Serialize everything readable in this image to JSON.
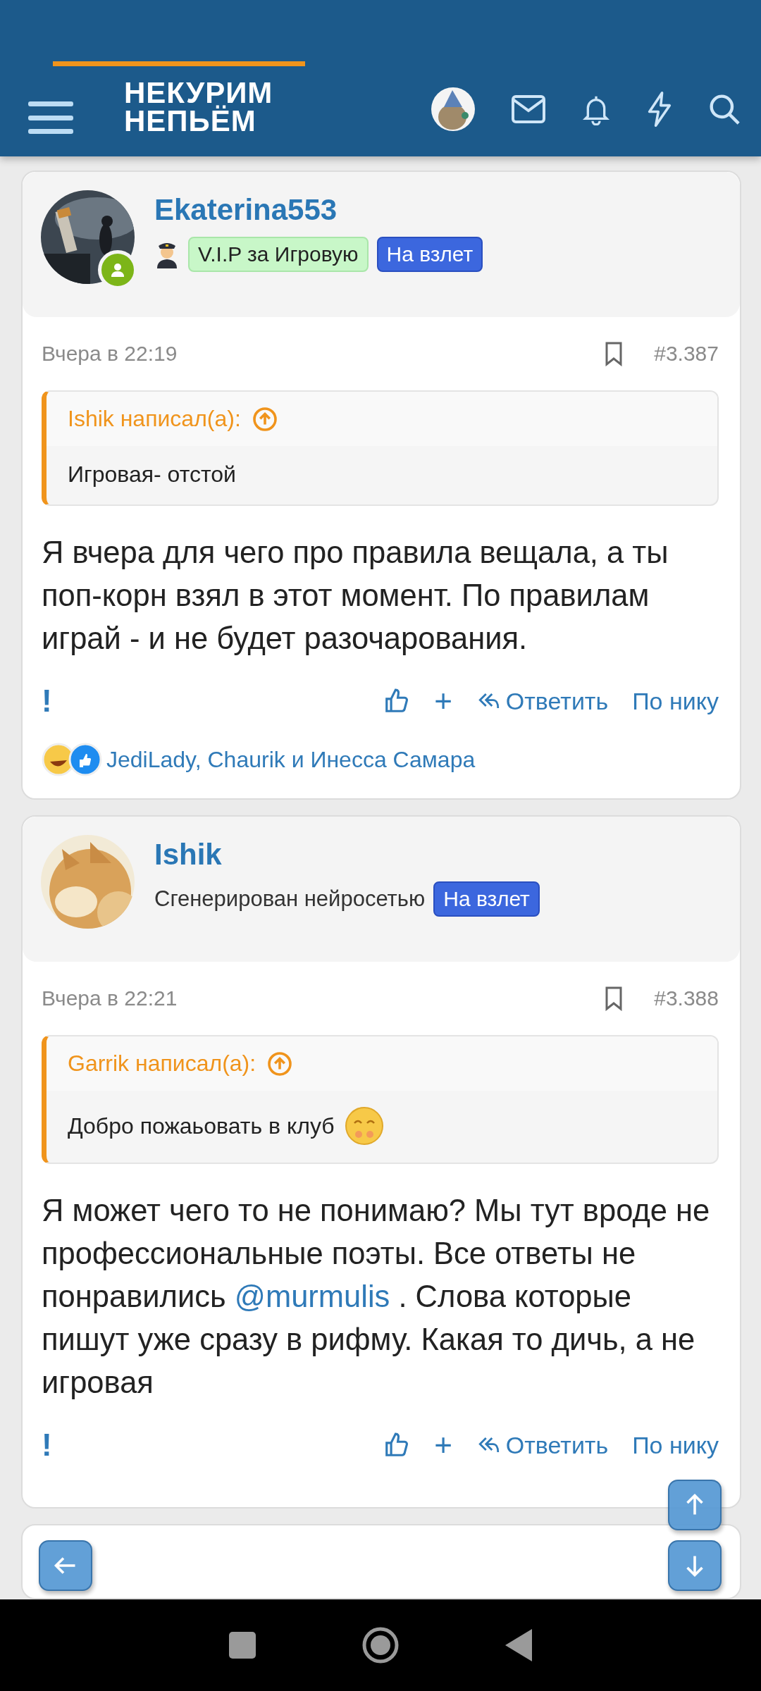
{
  "header": {
    "logo": [
      "НЕКУРИМ",
      "НЕПЬЁМ"
    ]
  },
  "posts": [
    {
      "author": "Ekaterina553",
      "online": true,
      "user_line": [
        {
          "kind": "pilot_icon"
        },
        {
          "kind": "tag_green",
          "text": "V.I.P за Игровую"
        },
        {
          "kind": "tag_blue",
          "text": "На взлет"
        }
      ],
      "date": "Вчера в 22:19",
      "number": "#3.387",
      "quote": {
        "header": "Ishik написал(а):",
        "text": "Игровая- отстой"
      },
      "body": [
        {
          "kind": "text",
          "text": "Я вчера для чего про правила вещала, а ты поп-корн взял в этот момент. По правилам играй - и не будет разочарования."
        }
      ],
      "actions": {
        "report": "!",
        "plus": "+",
        "reply": "Ответить",
        "by_nick": "По нику"
      },
      "reactions": {
        "text": "JediLady, Chaurik и Инесса Самара"
      }
    },
    {
      "author": "Ishik",
      "user_line": [
        {
          "kind": "title",
          "text": "Сгенерирован нейросетью"
        },
        {
          "kind": "tag_blue",
          "text": "На взлет"
        }
      ],
      "date": "Вчера в 22:21",
      "number": "#3.388",
      "quote": {
        "header": "Garrik написал(а):",
        "text": "Добро пожаьовать в клуб",
        "trailing_emoji": true
      },
      "body": [
        {
          "kind": "text",
          "text": "Я может чего то не понимаю? Мы тут вроде не профессиональные поэты. Все ответы не понравились "
        },
        {
          "kind": "mention",
          "text": "@murmulis"
        },
        {
          "kind": "text",
          "text": " . Слова которые пишут уже сразу в рифму. Какая то дичь, а не игровая"
        }
      ],
      "actions": {
        "report": "!",
        "plus": "+",
        "reply": "Ответить",
        "by_nick": "По нику"
      }
    }
  ]
}
